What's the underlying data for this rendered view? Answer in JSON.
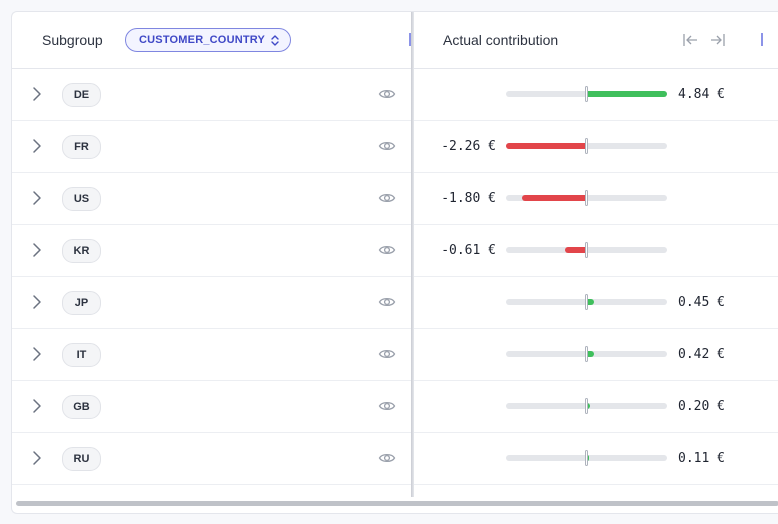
{
  "header": {
    "subgroup_label": "Subgroup",
    "group_selector": "CUSTOMER_COUNTRY",
    "contribution_label": "Actual contribution",
    "collapse_left_icon": "collapse-left-icon",
    "collapse_right_icon": "expand-right-icon"
  },
  "colors": {
    "positive": "#3fbf5c",
    "negative": "#e2454a",
    "accent": "#3f48c6"
  },
  "rows": [
    {
      "label": "DE",
      "value": 4.84,
      "value_text": "4.84 €"
    },
    {
      "label": "FR",
      "value": -2.26,
      "value_text": "-2.26 €"
    },
    {
      "label": "US",
      "value": -1.8,
      "value_text": "-1.80 €"
    },
    {
      "label": "KR",
      "value": -0.61,
      "value_text": "-0.61 €"
    },
    {
      "label": "JP",
      "value": 0.45,
      "value_text": "0.45 €"
    },
    {
      "label": "IT",
      "value": 0.42,
      "value_text": "0.42 €"
    },
    {
      "label": "GB",
      "value": 0.2,
      "value_text": "0.20 €"
    },
    {
      "label": "RU",
      "value": 0.11,
      "value_text": "0.11 €"
    }
  ],
  "bar_scale_max": 4.84
}
